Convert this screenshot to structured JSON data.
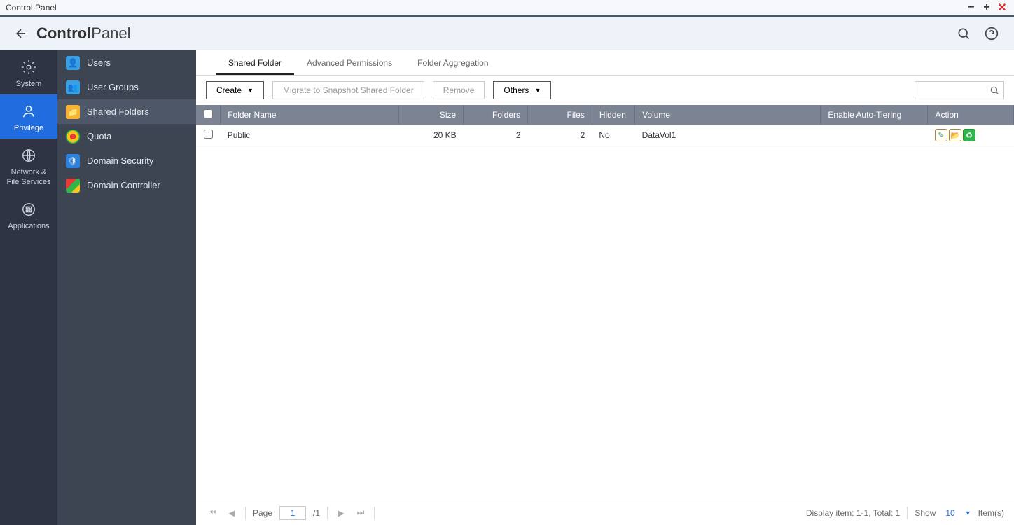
{
  "window": {
    "title": "Control Panel"
  },
  "header": {
    "title_bold": "Control",
    "title_light": "Panel"
  },
  "nav": {
    "items": [
      {
        "label": "System",
        "icon": "gear"
      },
      {
        "label": "Privilege",
        "icon": "user"
      },
      {
        "label": "Network &\nFile Services",
        "icon": "globe"
      },
      {
        "label": "Applications",
        "icon": "grid"
      }
    ],
    "active_index": 1
  },
  "sidebar": {
    "items": [
      {
        "label": "Users"
      },
      {
        "label": "User Groups"
      },
      {
        "label": "Shared Folders"
      },
      {
        "label": "Quota"
      },
      {
        "label": "Domain Security"
      },
      {
        "label": "Domain Controller"
      }
    ],
    "active_index": 2
  },
  "tabs": {
    "items": [
      "Shared Folder",
      "Advanced Permissions",
      "Folder Aggregation"
    ],
    "active_index": 0
  },
  "toolbar": {
    "create_label": "Create",
    "migrate_label": "Migrate to Snapshot Shared Folder",
    "remove_label": "Remove",
    "others_label": "Others"
  },
  "table": {
    "headers": {
      "folder_name": "Folder Name",
      "size": "Size",
      "folders": "Folders",
      "files": "Files",
      "hidden": "Hidden",
      "volume": "Volume",
      "auto_tiering": "Enable Auto-Tiering",
      "action": "Action"
    },
    "rows": [
      {
        "folder_name": "Public",
        "size": "20 KB",
        "folders": "2",
        "files": "2",
        "hidden": "No",
        "volume": "DataVol1",
        "auto_tiering": ""
      }
    ]
  },
  "pager": {
    "page_label": "Page",
    "current_page": "1",
    "total_pages": "/1",
    "display_text": "Display item: 1-1, Total: 1",
    "show_label": "Show",
    "show_count": "10",
    "items_label": "Item(s)"
  }
}
